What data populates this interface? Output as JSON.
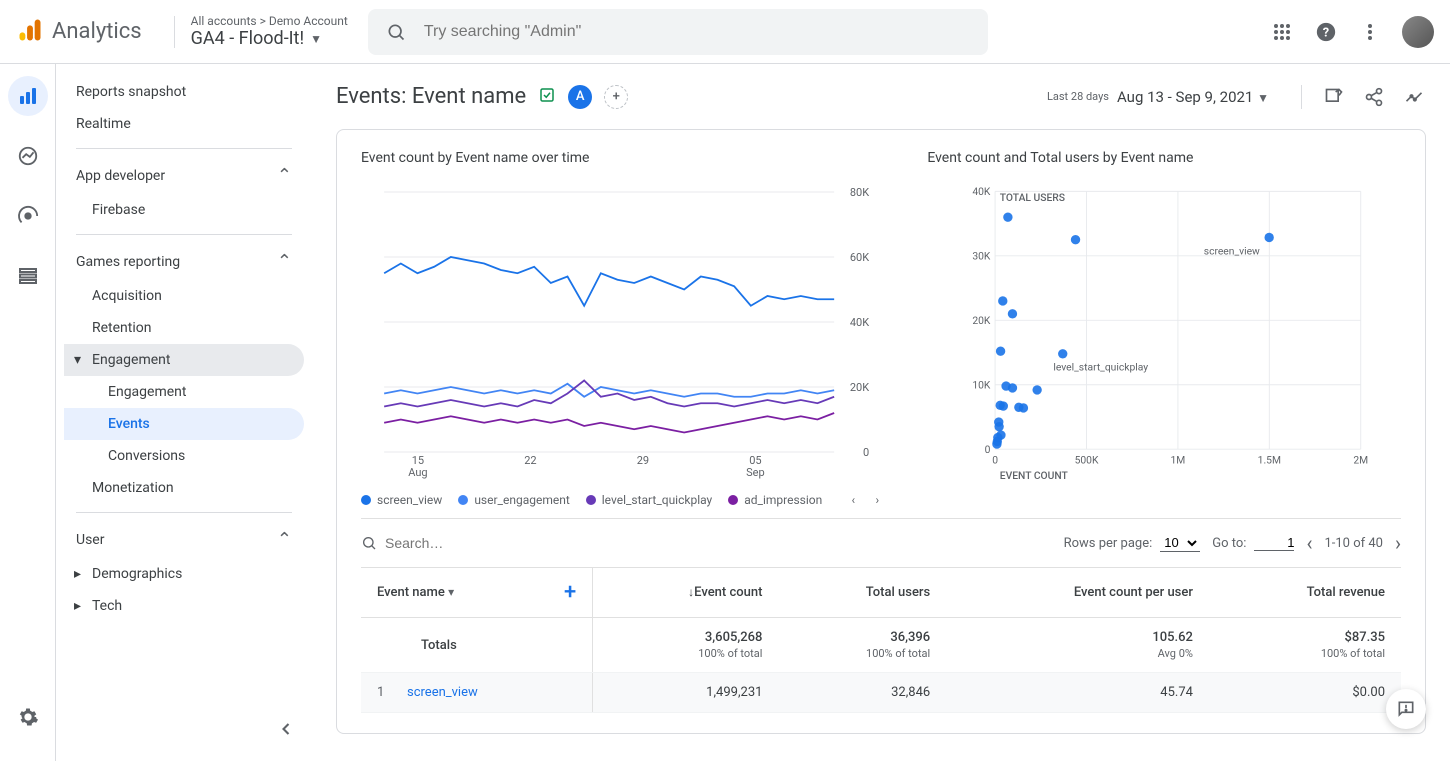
{
  "header": {
    "product": "Analytics",
    "breadcrumb_top": "All accounts > Demo Account",
    "breadcrumb_bottom": "GA4 - Flood-It!",
    "search_placeholder": "Try searching \"Admin\""
  },
  "sidebar": {
    "items": [
      {
        "label": "Reports snapshot",
        "level": 0
      },
      {
        "label": "Realtime",
        "level": 0
      },
      {
        "sep": true
      },
      {
        "label": "App developer",
        "level": 0,
        "expand": true
      },
      {
        "label": "Firebase",
        "level": 1
      },
      {
        "sep": true
      },
      {
        "label": "Games reporting",
        "level": 0,
        "expand": true,
        "bg": true
      },
      {
        "label": "Acquisition",
        "level": 1
      },
      {
        "label": "Retention",
        "level": 1
      },
      {
        "label": "Engagement",
        "level": 1,
        "arrow": true,
        "selgrp": true
      },
      {
        "label": "Engagement",
        "level": 2
      },
      {
        "label": "Events",
        "level": 2,
        "active": true
      },
      {
        "label": "Conversions",
        "level": 2
      },
      {
        "label": "Monetization",
        "level": 1
      },
      {
        "sep": true
      },
      {
        "label": "User",
        "level": 0,
        "expand": true
      },
      {
        "label": "Demographics",
        "level": 1,
        "arrow": "right"
      },
      {
        "label": "Tech",
        "level": 1,
        "arrow": "right"
      }
    ]
  },
  "page": {
    "title": "Events: Event name",
    "date_label": "Last 28 days",
    "date_range": "Aug 13 - Sep 9, 2021",
    "chip": "A"
  },
  "chart_data": [
    {
      "type": "line",
      "title": "Event count by Event name over time",
      "ylim": [
        0,
        80000
      ],
      "yticks": [
        0,
        20000,
        40000,
        60000,
        80000
      ],
      "ytick_labels": [
        "0",
        "20K",
        "40K",
        "60K",
        "80K"
      ],
      "x_labels": [
        "15\nAug",
        "22",
        "29",
        "05\nSep"
      ],
      "series": [
        {
          "name": "screen_view",
          "color": "#1a73e8",
          "values": [
            55,
            58,
            55,
            57,
            60,
            59,
            58,
            56,
            55,
            57,
            52,
            54,
            45,
            55,
            53,
            52,
            54,
            52,
            50,
            54,
            53,
            51,
            45,
            48,
            47,
            48,
            47,
            47
          ]
        },
        {
          "name": "user_engagement",
          "color": "#4285f4",
          "values": [
            18,
            19,
            18,
            19,
            20,
            19,
            18,
            19,
            18,
            19,
            18,
            21,
            17,
            20,
            19,
            18,
            19,
            18,
            17,
            18,
            18,
            17,
            17,
            18,
            18,
            19,
            18,
            19
          ]
        },
        {
          "name": "level_start_quickplay",
          "color": "#673ab7",
          "values": [
            14,
            15,
            14,
            15,
            16,
            15,
            14,
            15,
            14,
            16,
            15,
            18,
            22,
            17,
            18,
            16,
            17,
            15,
            14,
            15,
            15,
            14,
            15,
            16,
            15,
            16,
            15,
            17
          ]
        },
        {
          "name": "ad_impression",
          "color": "#7b1fa2",
          "values": [
            9,
            10,
            9,
            10,
            11,
            10,
            9,
            10,
            9,
            10,
            9,
            10,
            8,
            9,
            8,
            7,
            8,
            7,
            6,
            7,
            8,
            9,
            10,
            11,
            10,
            11,
            10,
            12
          ]
        }
      ]
    },
    {
      "type": "scatter",
      "title": "Event count and Total users by Event name",
      "xlabel": "EVENT COUNT",
      "ylabel": "TOTAL USERS",
      "xlim": [
        0,
        2000000
      ],
      "xticks": [
        0,
        500000,
        1000000,
        1500000,
        2000000
      ],
      "xtick_labels": [
        "0",
        "500K",
        "1M",
        "1.5M",
        "2M"
      ],
      "ylim": [
        0,
        40000
      ],
      "yticks": [
        0,
        10000,
        20000,
        30000,
        40000
      ],
      "ytick_labels": [
        "0",
        "10K",
        "20K",
        "30K",
        "40K"
      ],
      "points": [
        {
          "x": 1499231,
          "y": 32846,
          "label": "screen_view"
        },
        {
          "x": 440000,
          "y": 32500,
          "label": ""
        },
        {
          "x": 70000,
          "y": 36000,
          "label": ""
        },
        {
          "x": 95000,
          "y": 21000,
          "label": ""
        },
        {
          "x": 42000,
          "y": 23000,
          "label": ""
        },
        {
          "x": 370000,
          "y": 14800,
          "label": "level_start_quickplay"
        },
        {
          "x": 30000,
          "y": 15200,
          "label": ""
        },
        {
          "x": 60000,
          "y": 9800,
          "label": ""
        },
        {
          "x": 95000,
          "y": 9500,
          "label": ""
        },
        {
          "x": 230000,
          "y": 9200,
          "label": ""
        },
        {
          "x": 28000,
          "y": 6800,
          "label": ""
        },
        {
          "x": 45000,
          "y": 6700,
          "label": ""
        },
        {
          "x": 130000,
          "y": 6500,
          "label": ""
        },
        {
          "x": 155000,
          "y": 6400,
          "label": ""
        },
        {
          "x": 20000,
          "y": 4200,
          "label": ""
        },
        {
          "x": 22000,
          "y": 3500,
          "label": ""
        },
        {
          "x": 32000,
          "y": 2200,
          "label": ""
        },
        {
          "x": 15000,
          "y": 1800,
          "label": ""
        },
        {
          "x": 12000,
          "y": 1200,
          "label": ""
        },
        {
          "x": 10000,
          "y": 800,
          "label": ""
        }
      ]
    }
  ],
  "table": {
    "search_placeholder": "Search…",
    "rows_per_page_label": "Rows per page:",
    "rows_per_page": "10",
    "goto_label": "Go to:",
    "goto_value": "1",
    "page_info": "1-10 of 40",
    "columns": [
      "Event name",
      "Event count",
      "Total users",
      "Event count per user",
      "Total revenue"
    ],
    "totals": {
      "label": "Totals",
      "cells": [
        {
          "val": "3,605,268",
          "sub": "100% of total"
        },
        {
          "val": "36,396",
          "sub": "100% of total"
        },
        {
          "val": "105.62",
          "sub": "Avg 0%"
        },
        {
          "val": "$87.35",
          "sub": "100% of total"
        }
      ]
    },
    "rows": [
      {
        "n": "1",
        "name": "screen_view",
        "cells": [
          "1,499,231",
          "32,846",
          "45.74",
          "$0.00"
        ]
      }
    ]
  }
}
